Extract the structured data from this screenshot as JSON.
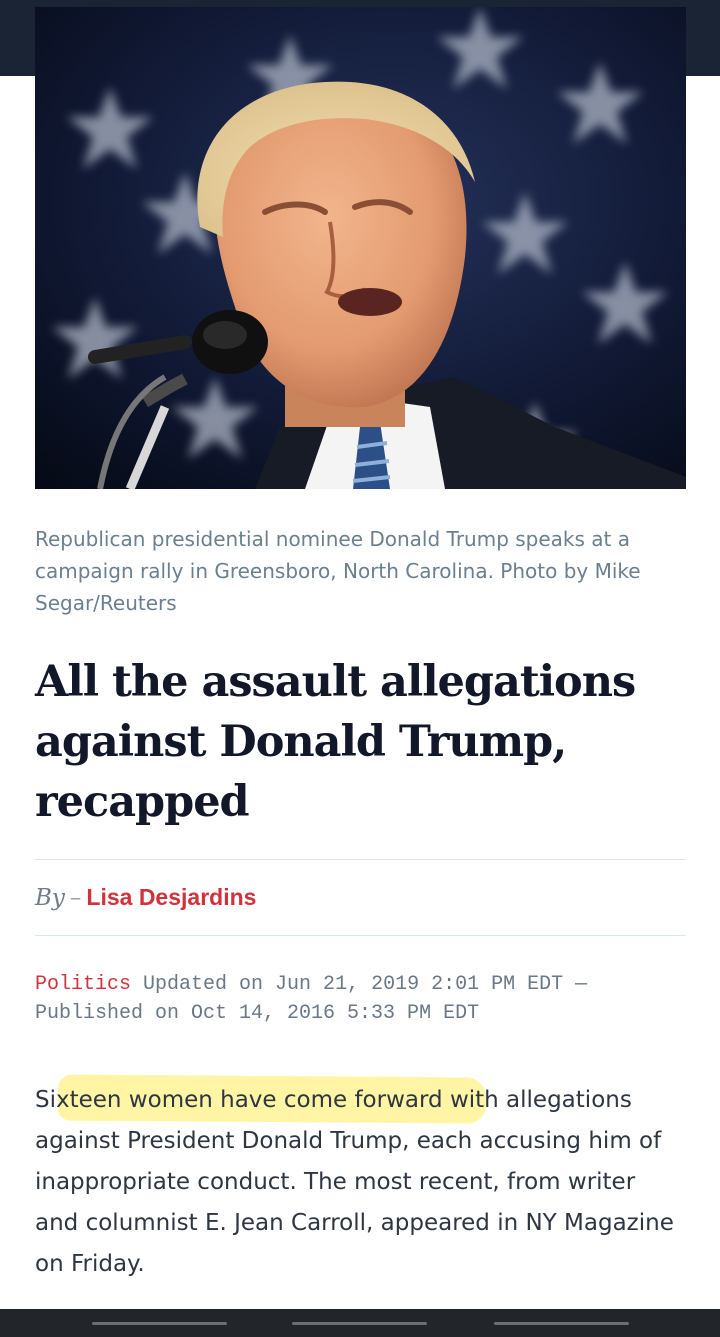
{
  "hero_image": {
    "alt": "Photo of Donald Trump speaking into a microphone in front of a starry backdrop"
  },
  "caption": "Republican presidential nominee Donald Trump speaks at a campaign rally in Greensboro, North Carolina. Photo by Mike Segar/Reuters",
  "headline": "All the assault allegations against Donald Trump, recapped",
  "byline": {
    "by_label": "By",
    "dash": "–",
    "author": "Lisa Desjardins"
  },
  "meta": {
    "category": "Politics",
    "updated_text": "Updated on Jun 21, 2019 2:01 PM EDT — Published on Oct 14, 2016 5:33 PM EDT"
  },
  "body_paragraph": "Sixteen women have come forward with allegations against President Donald Trump, each accusing him of inappropriate conduct. The most recent, from writer and columnist E. Jean Carroll, appeared in NY Magazine on Friday.",
  "colors": {
    "accent_red": "#d0333b",
    "headline_navy": "#12182a",
    "caption_gray": "#6c7f8d",
    "highlight_yellow": "#ffec5a",
    "top_band": "#1b2434"
  }
}
